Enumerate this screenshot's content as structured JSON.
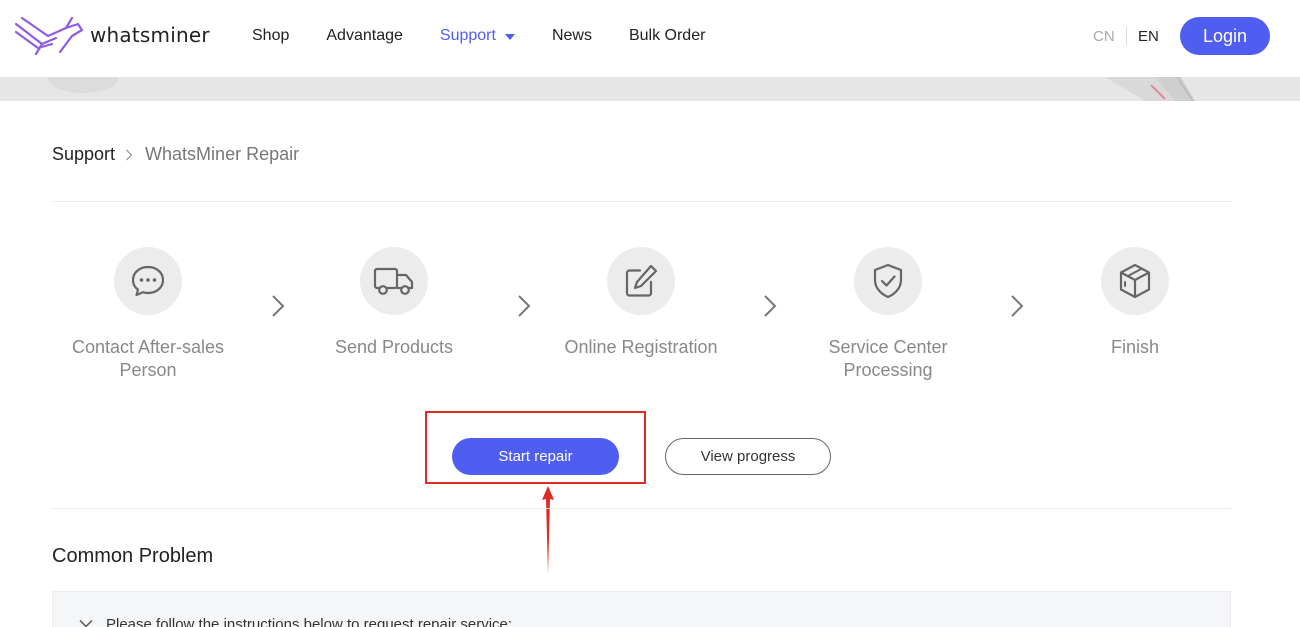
{
  "header": {
    "logo_text": "whatsminer",
    "nav": [
      {
        "label": "Shop"
      },
      {
        "label": "Advantage"
      },
      {
        "label": "Support"
      },
      {
        "label": "News"
      },
      {
        "label": "Bulk Order"
      }
    ],
    "active_nav": "Support",
    "lang_cn": "CN",
    "lang_en": "EN",
    "login_label": "Login"
  },
  "breadcrumb": {
    "root": "Support",
    "current": "WhatsMiner Repair"
  },
  "steps": [
    {
      "label": "Contact After-sales Person",
      "icon": "chat-icon"
    },
    {
      "label": "Send Products",
      "icon": "truck-icon"
    },
    {
      "label": "Online Registration",
      "icon": "edit-icon"
    },
    {
      "label": "Service Center Processing",
      "icon": "shield-check-icon"
    },
    {
      "label": "Finish",
      "icon": "box-icon"
    }
  ],
  "actions": {
    "start_label": "Start repair",
    "view_label": "View progress"
  },
  "common_problem": {
    "title": "Common Problem",
    "items": [
      {
        "text": "Please follow the instructions below to request repair service:"
      }
    ]
  },
  "colors": {
    "accent": "#4f5ef0",
    "annotation": "#e02a22"
  }
}
